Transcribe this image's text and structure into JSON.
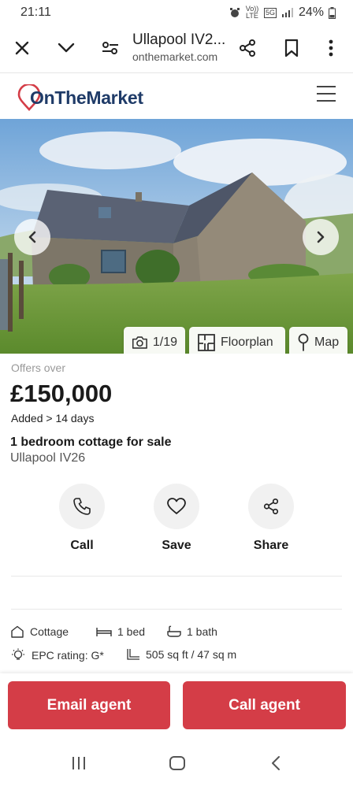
{
  "status_bar": {
    "time": "21:11",
    "volte": "Vo)) LTE",
    "network": "5G",
    "battery": "24%"
  },
  "browser": {
    "title": "Ullapool IV2...",
    "domain": "onthemarket.com"
  },
  "site": {
    "logo_text": "OnTheMarket"
  },
  "gallery": {
    "photo_count": "1/19",
    "floorplan_label": "Floorplan",
    "map_label": "Map"
  },
  "listing": {
    "price_qualifier": "Offers over",
    "price": "£150,000",
    "added": "Added > 14 days",
    "title": "1 bedroom cottage for sale",
    "location": "Ullapool IV26"
  },
  "actions": {
    "call": "Call",
    "save": "Save",
    "share": "Share"
  },
  "features": {
    "type": "Cottage",
    "beds": "1 bed",
    "baths": "1 bath",
    "epc": "EPC rating: G*",
    "size": "505 sq ft / 47 sq m"
  },
  "cta": {
    "email": "Email agent",
    "call": "Call agent"
  },
  "colors": {
    "brand_red": "#d43d47",
    "brand_navy": "#1f3b68"
  }
}
